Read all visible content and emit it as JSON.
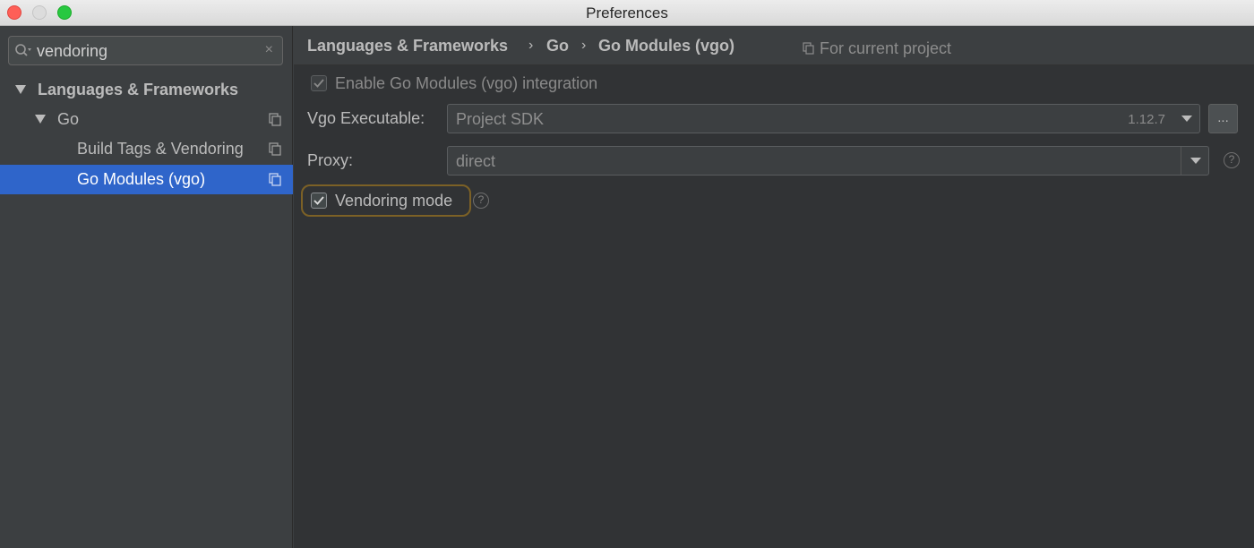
{
  "window": {
    "title": "Preferences"
  },
  "sidebar": {
    "search": {
      "value": "vendoring",
      "clear_glyph": "×"
    },
    "tree": [
      {
        "label": "Languages & Frameworks",
        "expanded": true
      },
      {
        "label": "Go",
        "expanded": true
      },
      {
        "label": "Build Tags & Vendoring"
      },
      {
        "label": "Go Modules (vgo)",
        "selected": true
      }
    ]
  },
  "breadcrumb": {
    "items": [
      "Languages & Frameworks",
      "Go",
      "Go Modules (vgo)"
    ],
    "separator": "›",
    "scope": "For current project"
  },
  "settings": {
    "enable_modules": {
      "label": "Enable Go Modules (vgo) integration",
      "checked": true,
      "disabled": true
    },
    "vgo_executable": {
      "label": "Vgo Executable:",
      "value": "Project SDK",
      "version": "1.12.7",
      "browse": "..."
    },
    "proxy": {
      "label": "Proxy:",
      "value": "direct",
      "help": "?"
    },
    "vendoring_mode": {
      "label": "Vendoring mode",
      "checked": true,
      "help": "?"
    }
  },
  "colors": {
    "selection": "#2f65ca",
    "focus_ring": "#7c6126",
    "panel_bg": "#313335",
    "sidebar_bg": "#3c3f41"
  }
}
